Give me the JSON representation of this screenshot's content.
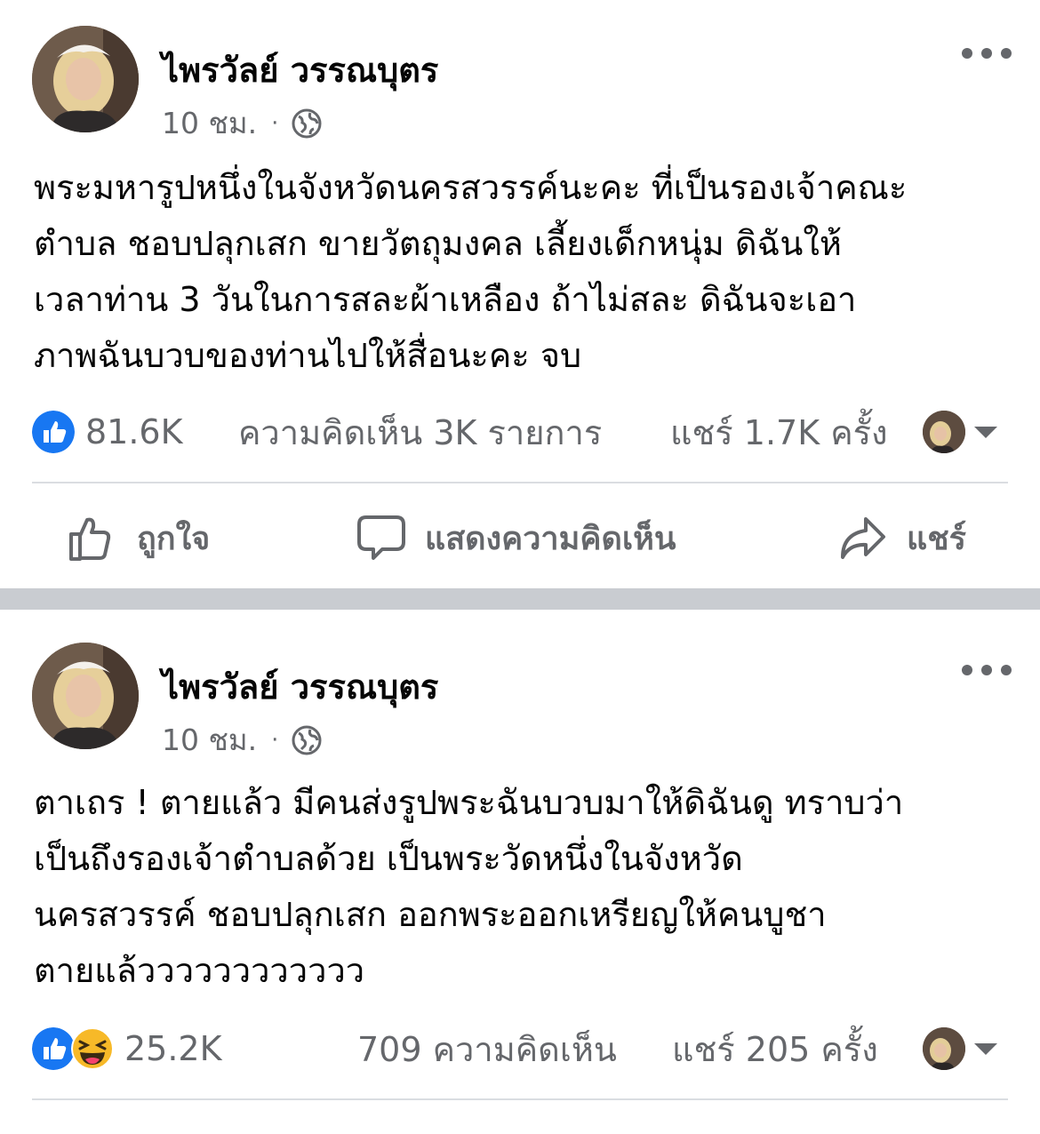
{
  "post1": {
    "author": "ไพรวัลย์ วรรณบุตร",
    "time": "10 ชม.",
    "dot": "·",
    "lines": [
      "พระมหารูปหนึ่งในจังหวัดนครสวรรค์นะคะ ที่เป็นรองเจ้าคณะ",
      "ตำบล ชอบปลุกเสก ขายวัตถุมงคล เลี้ยงเด็กหนุ่ม ดิฉันให้",
      "เวลาท่าน 3 วันในการสละผ้าเหลือง ถ้าไม่สละ ดิฉันจะเอา",
      "ภาพฉันบวบของท่านไปให้สื่อนะคะ จบ"
    ],
    "reactions_count": "81.6K",
    "comments": "ความคิดเห็น 3K รายการ",
    "shares": "แชร์ 1.7K ครั้ง",
    "like_label": "ถูกใจ",
    "comment_label": "แสดงความคิดเห็น",
    "share_label": "แชร์"
  },
  "post2": {
    "author": "ไพรวัลย์ วรรณบุตร",
    "time": "10 ชม.",
    "dot": "·",
    "lines": [
      "ตาเถร ! ตายแล้ว มีคนส่งรูปพระฉันบวบมาให้ดิฉันดู ทราบว่า",
      "เป็นถึงรองเจ้าตำบลด้วย เป็นพระวัดหนึ่งในจังหวัด",
      "นครสวรรค์ ชอบปลุกเสก ออกพระออกเหรียญให้คนบูชา",
      "ตายแล้วววววววววววว"
    ],
    "reactions_count": "25.2K",
    "comments": "709 ความคิดเห็น",
    "shares": "แชร์ 205 ครั้ง"
  },
  "icons": {
    "like": "thumbs-up-icon",
    "haha": "laughing-emoji-icon",
    "globe": "globe-icon",
    "more": "more-dots-icon",
    "comment": "speech-bubble-icon",
    "share": "share-arrow-icon"
  },
  "colors": {
    "like_blue": "#1877f2",
    "haha_yellow": "#f7b928",
    "secondary_text": "#65676b",
    "separator": "#c9ccd1"
  }
}
